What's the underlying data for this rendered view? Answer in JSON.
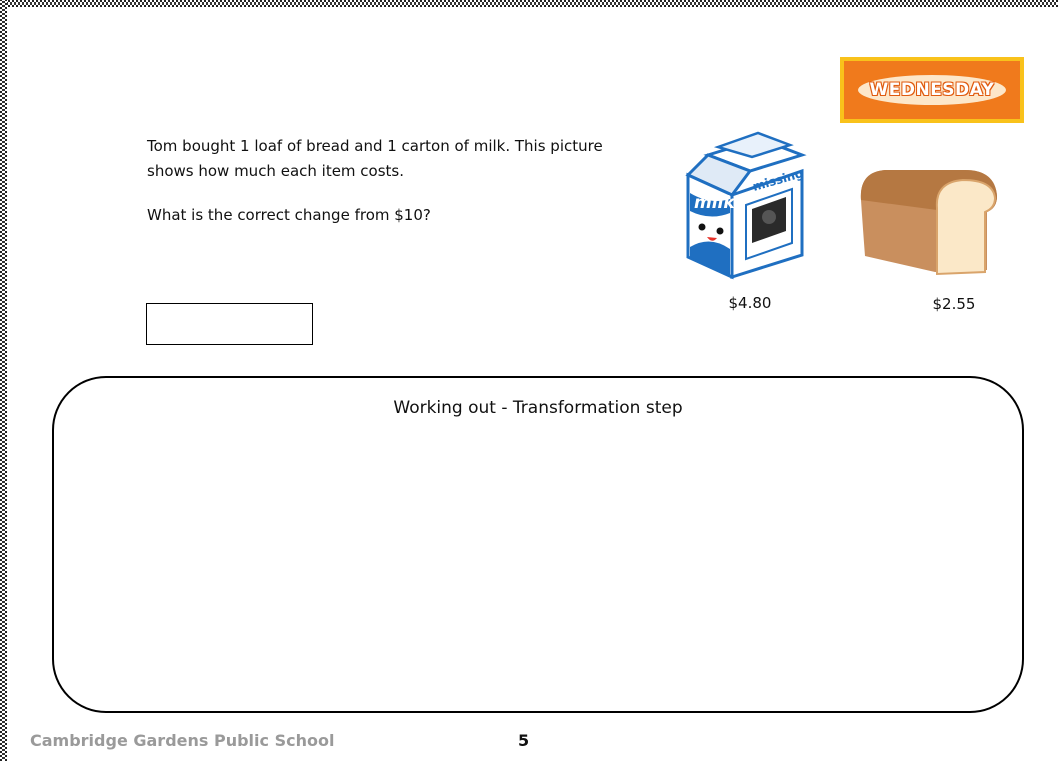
{
  "badge": {
    "day": "WEDNESDAY"
  },
  "question": {
    "line1": "Tom bought 1 loaf of bread and 1 carton of milk. This picture shows how much each item costs.",
    "line2": "What is the correct change from $10?"
  },
  "answer": {
    "value": ""
  },
  "items": {
    "milk": {
      "carton_text": "milk",
      "tag_text": "missing",
      "price": "$4.80"
    },
    "bread": {
      "price": "$2.55"
    }
  },
  "working": {
    "title": "Working out - Transformation step"
  },
  "footer": {
    "school": "Cambridge Gardens Public School",
    "page": "5"
  }
}
